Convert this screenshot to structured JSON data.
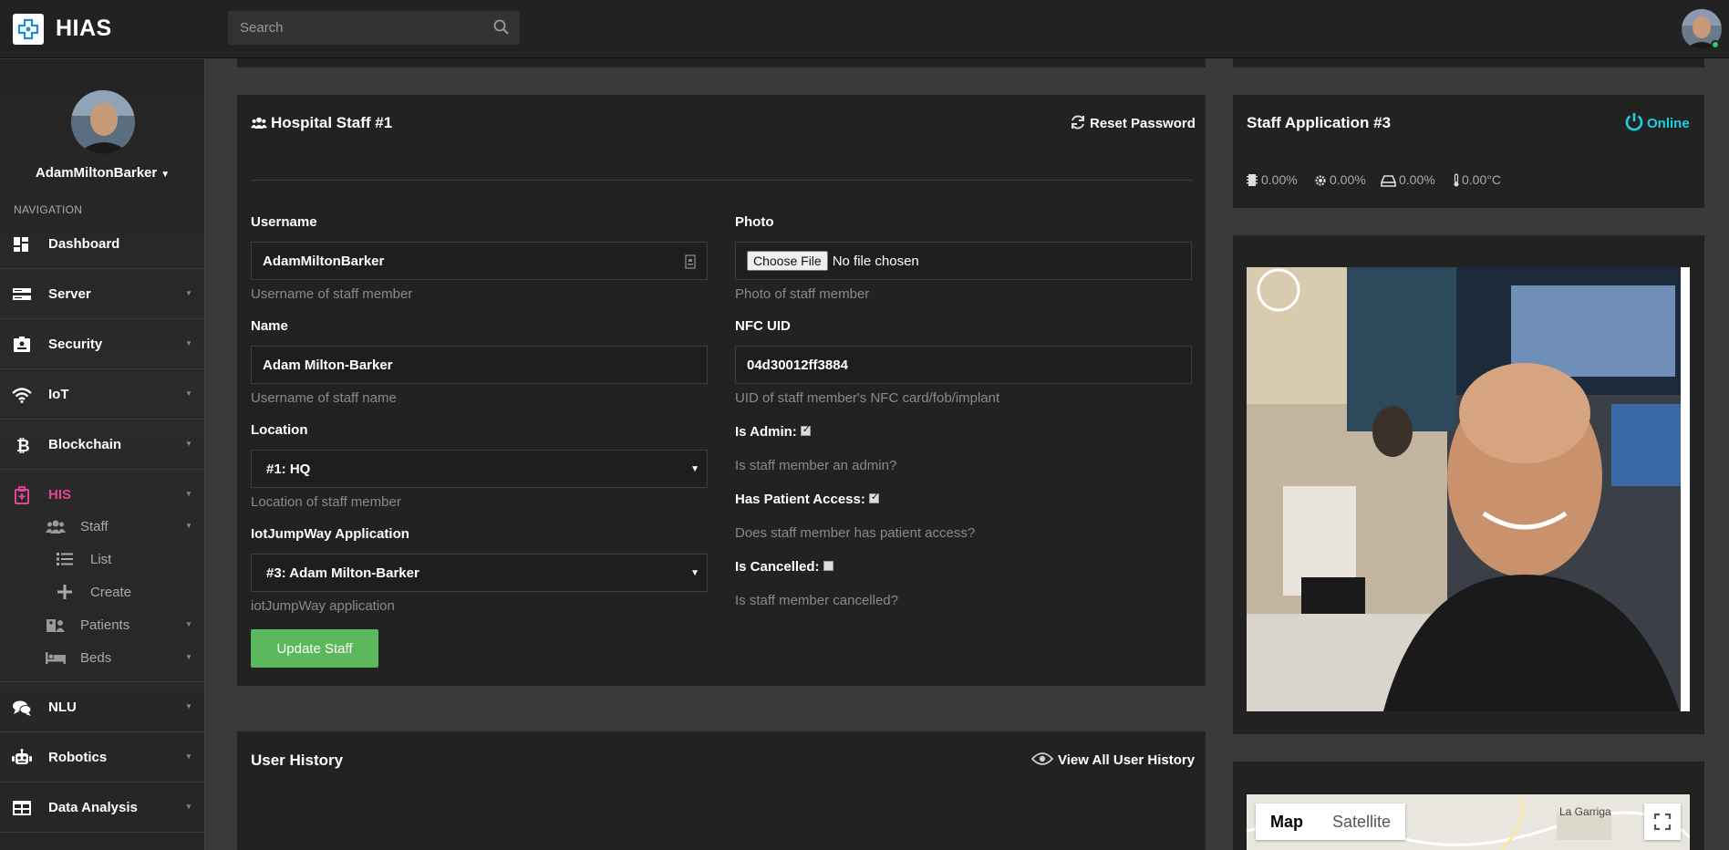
{
  "app": {
    "brand": "HIAS"
  },
  "search": {
    "placeholder": "Search"
  },
  "sidebar": {
    "username": "AdamMiltonBarker",
    "nav_heading": "NAVIGATION",
    "items": [
      {
        "label": "Dashboard",
        "icon": "dashboard-icon"
      },
      {
        "label": "Server",
        "icon": "server-icon"
      },
      {
        "label": "Security",
        "icon": "id-badge-icon"
      },
      {
        "label": "IoT",
        "icon": "wifi-icon"
      },
      {
        "label": "Blockchain",
        "icon": "bitcoin-icon"
      },
      {
        "label": "HIS",
        "icon": "hospital-icon"
      },
      {
        "label": "NLU",
        "icon": "comments-icon"
      },
      {
        "label": "Robotics",
        "icon": "robot-icon"
      },
      {
        "label": "Data Analysis",
        "icon": "table-icon"
      }
    ],
    "his_sub": {
      "staff": "Staff",
      "list": "List",
      "create": "Create",
      "patients": "Patients",
      "beds": "Beds"
    },
    "active_color": "#e84393"
  },
  "staff_panel": {
    "title": "Hospital Staff #1",
    "reset_password": "Reset Password",
    "username": {
      "label": "Username",
      "value": "AdamMiltonBarker",
      "help": "Username of staff member"
    },
    "name": {
      "label": "Name",
      "value": "Adam Milton-Barker",
      "help": "Username of staff name"
    },
    "location": {
      "label": "Location",
      "value": "#1: HQ",
      "help": "Location of staff member"
    },
    "application": {
      "label": "IotJumpWay Application",
      "value": "#3: Adam Milton-Barker",
      "help": "iotJumpWay application"
    },
    "photo": {
      "label": "Photo",
      "button": "Choose File",
      "status": "No file chosen",
      "help": "Photo of staff member"
    },
    "nfc": {
      "label": "NFC UID",
      "value": "04d30012ff3884",
      "help": "UID of staff member's NFC card/fob/implant"
    },
    "is_admin": {
      "label": "Is Admin:",
      "checked": true,
      "help": "Is staff member an admin?"
    },
    "patient_access": {
      "label": "Has Patient Access:",
      "checked": true,
      "help": "Does staff member has patient access?"
    },
    "is_cancelled": {
      "label": "Is Cancelled:",
      "checked": false,
      "help": "Is staff member cancelled?"
    },
    "update_button": "Update Staff",
    "button_color": "#5cb85c"
  },
  "app_panel": {
    "title": "Staff Application #3",
    "status": "Online",
    "status_color": "#1fd1e0",
    "stats": {
      "cpu": "0.00%",
      "memory": "0.00%",
      "disk": "0.00%",
      "temp": "0.00°C"
    }
  },
  "history_panel": {
    "title": "User History",
    "link": "View All User History"
  },
  "map": {
    "tab_map": "Map",
    "tab_satellite": "Satellite",
    "town_1": "La Garriga"
  }
}
